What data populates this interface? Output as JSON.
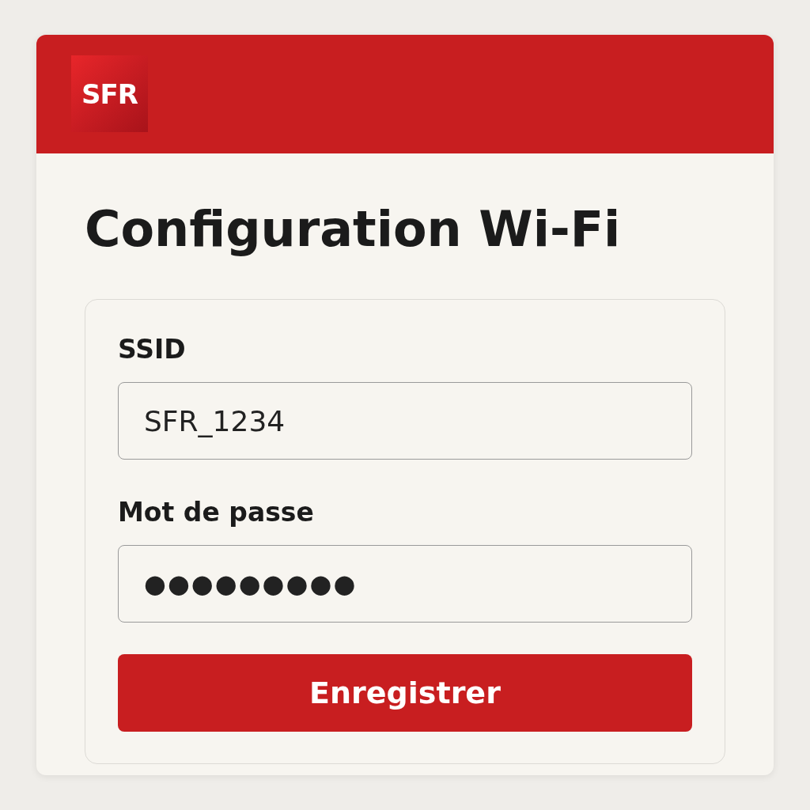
{
  "header": {
    "logo": "SFR"
  },
  "title": "Configuration Wi-Fi",
  "fields": [
    {
      "kind": "text",
      "label": "SSID",
      "value": "SFR_1234"
    },
    {
      "kind": "password",
      "label": "Mot de passe",
      "value": "●●●●●●●●●"
    }
  ],
  "button": "Enregistrer"
}
